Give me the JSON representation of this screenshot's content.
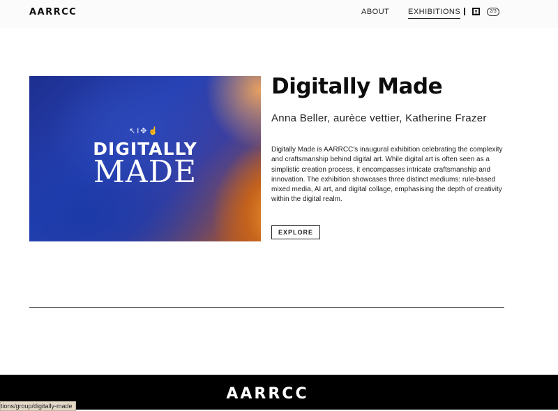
{
  "header": {
    "logo": "AARRCC",
    "nav": {
      "about": "ABOUT",
      "exhibitions": "EXHIBITIONS"
    },
    "page_indicator": "2/3",
    "icons": {
      "contact": "contact-card-icon"
    }
  },
  "exhibition": {
    "image": {
      "line1": "DIGITALLY",
      "line2": "MADE",
      "tools": "↖I✥☝"
    },
    "title": "Digitally Made",
    "artists": "Anna Beller, aurèce vettier, Katherine Frazer",
    "description": "Digitally Made is AARRCC's inaugural exhibition celebrating the complexity and craftsmanship behind digital art. While digital art is often seen as a simplistic creation process, it encompasses intricate craftsmanship and innovation. The exhibition showcases three distinct mediums: rule-based mixed media, AI art, and digital collage, emphasising the depth of creativity within the digital realm.",
    "explore_label": "EXPLORE"
  },
  "footer": {
    "logo": "AARRCC"
  },
  "status_bar": {
    "url": "tions/group/digitally-made"
  },
  "colors": {
    "footer_bg": "#000000",
    "accent": "#111111"
  }
}
